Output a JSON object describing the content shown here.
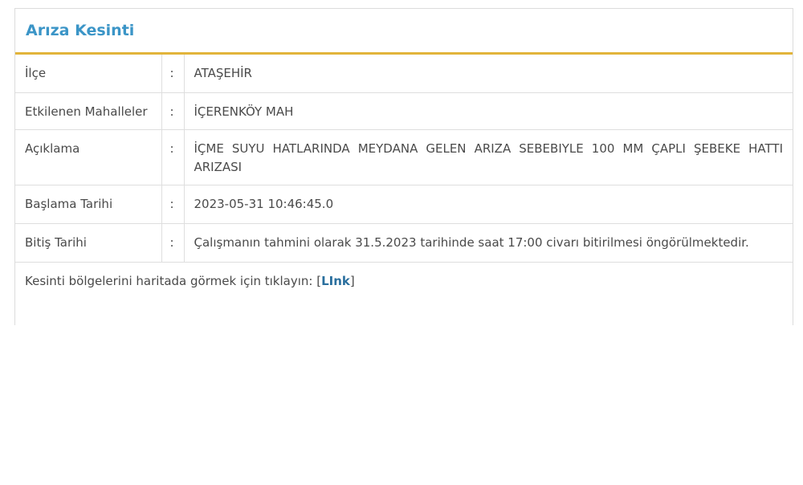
{
  "panel": {
    "title": "Arıza Kesinti"
  },
  "details": [
    {
      "label": "İlçe",
      "separator": ":",
      "value": "ATAŞEHİR"
    },
    {
      "label": "Etkilenen Mahalleler",
      "separator": ":",
      "value": "İÇERENKÖY MAH"
    },
    {
      "label": "Açıklama",
      "separator": ":",
      "value": "İÇME SUYU HATLARINDA MEYDANA GELEN ARIZA SEBEBIYLE 100 MM ÇAPLI ŞEBEKE HATTI ARIZASI"
    },
    {
      "label": "Başlama Tarihi",
      "separator": ":",
      "value": "2023-05-31 10:46:45.0"
    },
    {
      "label": "Bitiş Tarihi",
      "separator": ":",
      "value": "Çalışmanın tahmini olarak 31.5.2023 tarihinde saat 17:00 civarı bitirilmesi öngörülmektedir."
    }
  ],
  "footer": {
    "text": "Kesinti bölgelerini haritada görmek için tıklayın: ",
    "bracket_open": "[",
    "link_label": "LInk",
    "bracket_close": "]"
  },
  "colors": {
    "title": "#3b95c7",
    "header_underline": "#e2b43a",
    "link": "#2a6f9e"
  }
}
